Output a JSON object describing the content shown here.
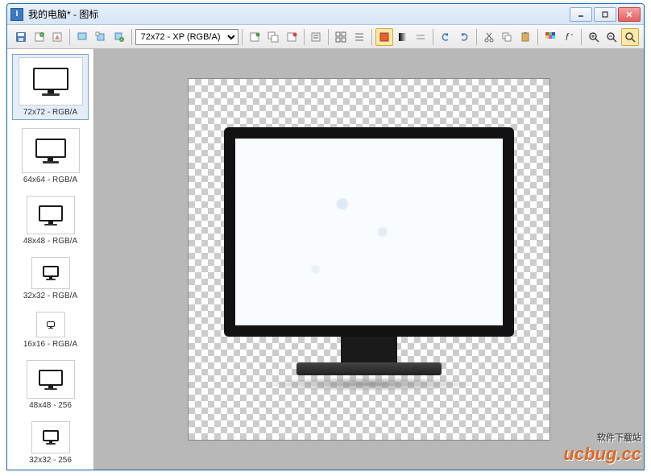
{
  "window": {
    "title": "我的电脑* - 图标",
    "app_icon_letter": "I"
  },
  "toolbar": {
    "size_selected": "72x72 - XP (RGB/A)"
  },
  "sidebar": {
    "items": [
      {
        "label": "72x72 - RGB/A",
        "size": 72,
        "selected": true
      },
      {
        "label": "64x64 - RGB/A",
        "size": 64,
        "selected": false
      },
      {
        "label": "48x48 - RGB/A",
        "size": 48,
        "selected": false
      },
      {
        "label": "32x32 - RGB/A",
        "size": 32,
        "selected": false
      },
      {
        "label": "16x16 - RGB/A",
        "size": 16,
        "selected": false
      },
      {
        "label": "48x48 - 256",
        "size": 48,
        "selected": false
      },
      {
        "label": "32x32 - 256",
        "size": 32,
        "selected": false
      }
    ]
  },
  "watermark": {
    "brand": "ucbug.cc",
    "tagline": "软件下载站"
  },
  "colors": {
    "titlebar_border": "#1a6fb5",
    "accent": "#3a7ac2",
    "close_red": "#e56060"
  }
}
